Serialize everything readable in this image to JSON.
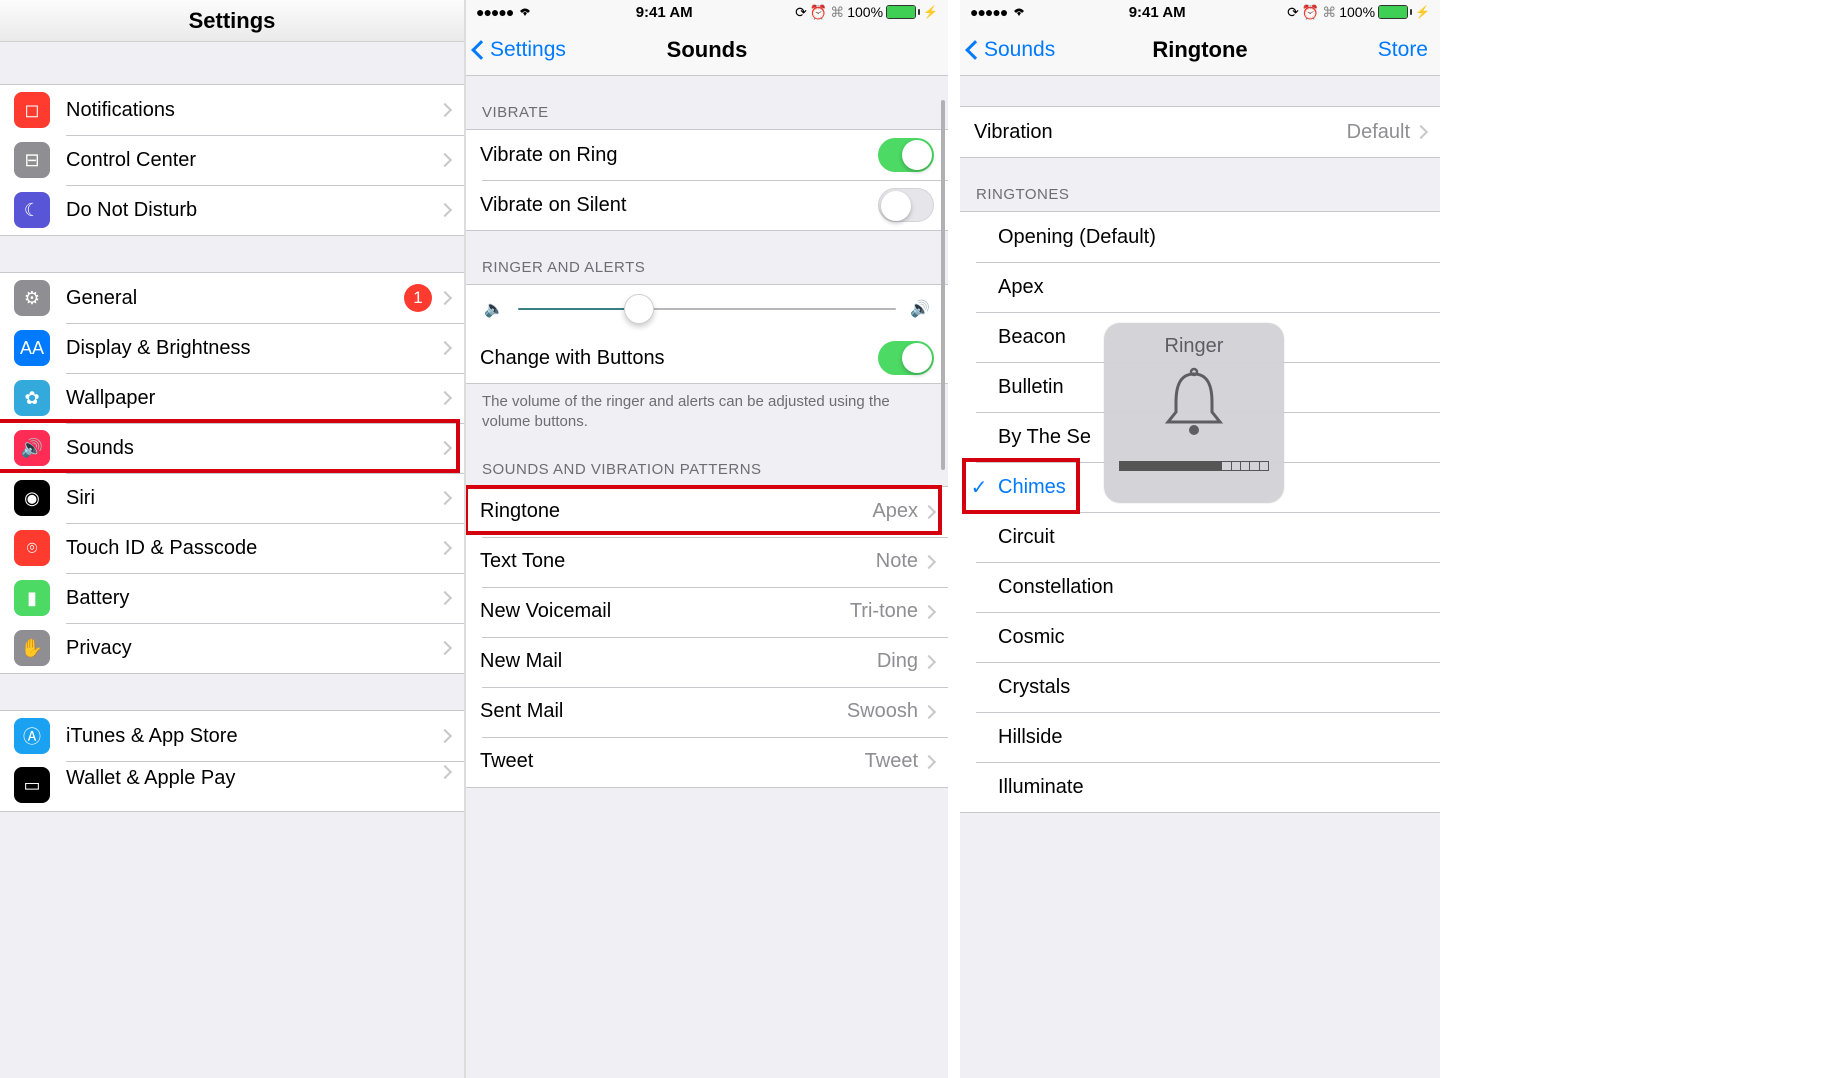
{
  "panel1": {
    "title": "Settings",
    "groups": [
      {
        "rows": [
          {
            "key": "notifications",
            "label": "Notifications",
            "iconName": "notifications-icon",
            "bg": "#ff3b30",
            "glyph": "◻"
          },
          {
            "key": "control-center",
            "label": "Control Center",
            "iconName": "control-center-icon",
            "bg": "#8e8e93",
            "glyph": "⊟"
          },
          {
            "key": "dnd",
            "label": "Do Not Disturb",
            "iconName": "moon-icon",
            "bg": "#5856d6",
            "glyph": "☾"
          }
        ]
      },
      {
        "rows": [
          {
            "key": "general",
            "label": "General",
            "iconName": "gear-icon",
            "bg": "#8e8e93",
            "glyph": "⚙",
            "badge": "1"
          },
          {
            "key": "display",
            "label": "Display & Brightness",
            "iconName": "display-icon",
            "bg": "#007aff",
            "glyph": "AA"
          },
          {
            "key": "wallpaper",
            "label": "Wallpaper",
            "iconName": "wallpaper-icon",
            "bg": "#34aadc",
            "glyph": "✿"
          },
          {
            "key": "sounds",
            "label": "Sounds",
            "iconName": "sounds-icon",
            "bg": "#ff2d55",
            "glyph": "🔊",
            "highlighted": true
          },
          {
            "key": "siri",
            "label": "Siri",
            "iconName": "siri-icon",
            "bg": "#000",
            "glyph": "◉"
          },
          {
            "key": "touchid",
            "label": "Touch ID & Passcode",
            "iconName": "touchid-icon",
            "bg": "#ff3b30",
            "glyph": "⌾"
          },
          {
            "key": "battery",
            "label": "Battery",
            "iconName": "battery-icon",
            "bg": "#4cd964",
            "glyph": "▮"
          },
          {
            "key": "privacy",
            "label": "Privacy",
            "iconName": "hand-icon",
            "bg": "#8e8e93",
            "glyph": "✋"
          }
        ]
      },
      {
        "rows": [
          {
            "key": "itunes",
            "label": "iTunes & App Store",
            "iconName": "appstore-icon",
            "bg": "#1ba1f2",
            "glyph": "Ⓐ"
          },
          {
            "key": "wallet",
            "label": "Wallet & Apple Pay",
            "iconName": "wallet-icon",
            "bg": "#000",
            "glyph": "▭",
            "cut": true
          }
        ]
      }
    ]
  },
  "panel2": {
    "statusTime": "9:41 AM",
    "batteryPct": "100%",
    "backLabel": "Settings",
    "title": "Sounds",
    "sections": {
      "vibrate": {
        "header": "VIBRATE",
        "rows": [
          {
            "key": "vib-ring",
            "label": "Vibrate on Ring",
            "on": true
          },
          {
            "key": "vib-silent",
            "label": "Vibrate on Silent",
            "on": false
          }
        ]
      },
      "ringer": {
        "header": "RINGER AND ALERTS",
        "changeLabel": "Change with Buttons",
        "changeOn": true,
        "footer": "The volume of the ringer and alerts can be adjusted using the volume buttons."
      },
      "patterns": {
        "header": "SOUNDS AND VIBRATION PATTERNS",
        "rows": [
          {
            "key": "ringtone",
            "label": "Ringtone",
            "detail": "Apex",
            "highlighted": true
          },
          {
            "key": "texttone",
            "label": "Text Tone",
            "detail": "Note"
          },
          {
            "key": "voicemail",
            "label": "New Voicemail",
            "detail": "Tri-tone"
          },
          {
            "key": "newmail",
            "label": "New Mail",
            "detail": "Ding"
          },
          {
            "key": "sentmail",
            "label": "Sent Mail",
            "detail": "Swoosh"
          },
          {
            "key": "tweet",
            "label": "Tweet",
            "detail": "Tweet"
          }
        ]
      }
    }
  },
  "panel3": {
    "statusTime": "9:41 AM",
    "batteryPct": "100%",
    "backLabel": "Sounds",
    "title": "Ringtone",
    "storeLabel": "Store",
    "vibrationLabel": "Vibration",
    "vibrationDetail": "Default",
    "ringtonesHeader": "RINGTONES",
    "ringtones": [
      {
        "label": "Opening (Default)"
      },
      {
        "label": "Apex"
      },
      {
        "label": "Beacon"
      },
      {
        "label": "Bulletin"
      },
      {
        "label": "By The Sea",
        "truncated": "By The Se"
      },
      {
        "label": "Chimes",
        "selected": true,
        "highlighted": true
      },
      {
        "label": "Circuit"
      },
      {
        "label": "Constellation"
      },
      {
        "label": "Cosmic"
      },
      {
        "label": "Crystals"
      },
      {
        "label": "Hillside"
      },
      {
        "label": "Illuminate"
      }
    ],
    "hud": {
      "title": "Ringer",
      "segmentsTotal": 16,
      "segmentsFilled": 11
    }
  }
}
